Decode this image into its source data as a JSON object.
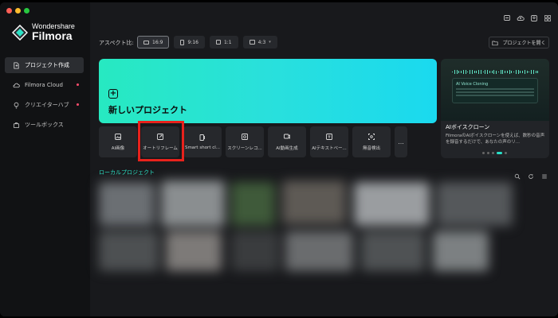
{
  "app": {
    "brand": "Wondershare",
    "name": "Filmora"
  },
  "sidebar": {
    "items": [
      {
        "label": "プロジェクト作成",
        "icon": "new-file-icon",
        "active": true,
        "badge": false
      },
      {
        "label": "Filmora Cloud",
        "icon": "cloud-icon",
        "active": false,
        "badge": true
      },
      {
        "label": "クリエイターハブ",
        "icon": "bulb-icon",
        "active": false,
        "badge": true
      },
      {
        "label": "ツールボックス",
        "icon": "toolbox-icon",
        "active": false,
        "badge": false
      }
    ]
  },
  "header": {
    "aspect_label": "アスペクト比:",
    "aspect_options": [
      "16:9",
      "9:16",
      "1:1",
      "4:3"
    ],
    "open_project": "プロジェクトを開く"
  },
  "new_project": {
    "label": "新しいプロジェクト",
    "gradient": [
      "#27e9c1",
      "#1ad9ef"
    ]
  },
  "promo": {
    "card_title": "AI Voice Cloning",
    "title": "AIボイスクローン",
    "description": "FilmoraのAIボイスクローンを使えば、数秒の音声を録音するだけで、あなたの声のリ..."
  },
  "tools": [
    {
      "label": "AI画像",
      "icon": "ai-image-icon"
    },
    {
      "label": "オートリフレーム",
      "icon": "auto-reframe-icon"
    },
    {
      "label": "Smart short cl...",
      "icon": "smart-short-clips-icon"
    },
    {
      "label": "スクリーンレコ...",
      "icon": "screen-recorder-icon"
    },
    {
      "label": "AI動画生成",
      "icon": "ai-video-icon"
    },
    {
      "label": "AIテキストベー...",
      "icon": "ai-text-based-icon"
    },
    {
      "label": "無音検出",
      "icon": "silence-detect-icon"
    }
  ],
  "more_label": "...",
  "local": {
    "label": "ローカルプロジェクト"
  },
  "colors": {
    "accent": "#2be3c6",
    "highlight": "#e8221c"
  }
}
